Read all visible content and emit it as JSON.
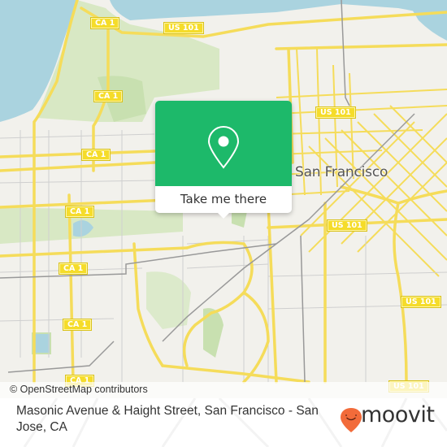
{
  "map": {
    "city_label": "San Francisco",
    "attribution": "© OpenStreetMap contributors",
    "route_shields": [
      {
        "label": "CA 1",
        "pos": "top-left-1"
      },
      {
        "label": "US 101",
        "pos": "top-center"
      },
      {
        "label": "CA 1",
        "pos": "left-2"
      },
      {
        "label": "CA 1",
        "pos": "left-3"
      },
      {
        "label": "CA 1",
        "pos": "left-4"
      },
      {
        "label": "CA 1",
        "pos": "left-5"
      },
      {
        "label": "CA 1",
        "pos": "left-6"
      },
      {
        "label": "CA 1",
        "pos": "bottom-left"
      },
      {
        "label": "US 101",
        "pos": "upper-right"
      },
      {
        "label": "US 101",
        "pos": "center-right"
      },
      {
        "label": "US 101",
        "pos": "right"
      },
      {
        "label": "US 101",
        "pos": "bottom-right"
      }
    ],
    "colors": {
      "land": "#f2f1ec",
      "water": "#aad3df",
      "park": "#d8e8c4",
      "road": "#f5dc5a",
      "rail": "#999999"
    }
  },
  "popup": {
    "icon": "map-pin-icon",
    "button_label": "Take me there",
    "accent_color": "#1db96a"
  },
  "footer": {
    "address": "Masonic Avenue & Haight Street, San Francisco - San Jose, CA",
    "brand": "moovit",
    "brand_color": "#f26b3a"
  }
}
